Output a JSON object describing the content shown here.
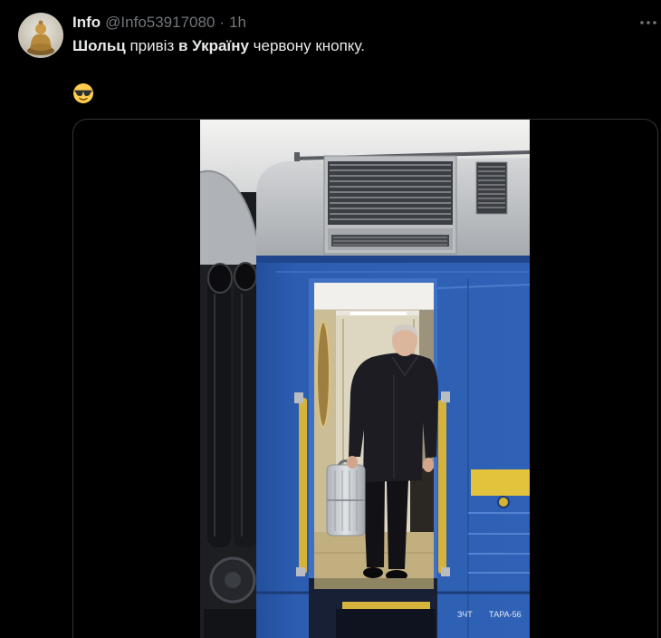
{
  "theme": {
    "background": "#000000",
    "text_primary": "#e7e9ea",
    "text_secondary": "#71767b",
    "border": "#2f3336"
  },
  "tweet": {
    "author": {
      "name": "Info",
      "handle": "@Info53917080",
      "avatar_icon": "golden-buddha-statue"
    },
    "separator": "·",
    "timestamp": "1h",
    "more_icon": "more-horizontal-icon",
    "text": [
      {
        "value": "Шольц",
        "bold": true
      },
      {
        "value": " привіз ",
        "bold": false
      },
      {
        "value": "в Україну",
        "bold": true
      },
      {
        "value": " червону кнопку.",
        "bold": false
      }
    ],
    "emoji_icon": "smiling-face-with-sunglasses",
    "media": {
      "markings": [
        "ЗЧТ",
        "ТАРА-56"
      ]
    }
  }
}
